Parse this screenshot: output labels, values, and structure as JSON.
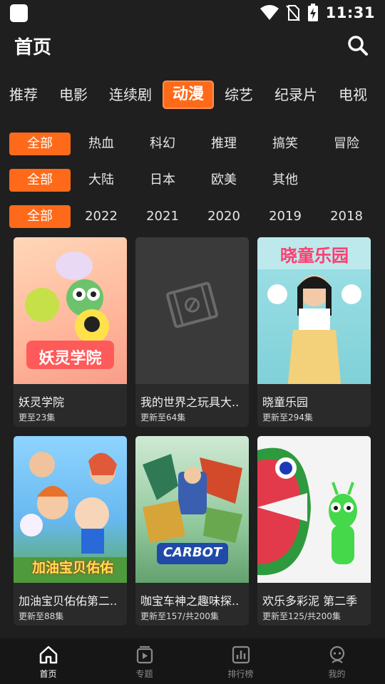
{
  "status_bar": {
    "time": "11:31"
  },
  "header": {
    "title": "首页",
    "search_icon": "search-icon"
  },
  "tabs": [
    {
      "label": "推荐",
      "active": false
    },
    {
      "label": "电影",
      "active": false
    },
    {
      "label": "连续剧",
      "active": false
    },
    {
      "label": "动漫",
      "active": true
    },
    {
      "label": "综艺",
      "active": false
    },
    {
      "label": "纪录片",
      "active": false
    },
    {
      "label": "电视",
      "active": false
    }
  ],
  "filters": {
    "genre": [
      "全部",
      "热血",
      "科幻",
      "推理",
      "搞笑",
      "冒险"
    ],
    "region": [
      "全部",
      "大陆",
      "日本",
      "欧美",
      "其他"
    ],
    "year": [
      "全部",
      "2022",
      "2021",
      "2020",
      "2019",
      "2018"
    ]
  },
  "cards": [
    {
      "title": "妖灵学院",
      "subtitle": "更至23集",
      "poster_text": "妖灵学院"
    },
    {
      "title": "我的世界之玩具大..",
      "subtitle": "更新至64集",
      "poster_text": ""
    },
    {
      "title": "晓童乐园",
      "subtitle": "更新至294集",
      "poster_text": "晓童乐园"
    },
    {
      "title": "加油宝贝佑佑第二..",
      "subtitle": "更新至88集",
      "poster_text": "加油宝贝佑佑"
    },
    {
      "title": "咖宝车神之趣味探..",
      "subtitle": "更新至157/共200集",
      "poster_text": "CARBOT"
    },
    {
      "title": "欢乐多彩泥 第二季",
      "subtitle": "更新至125/共200集",
      "poster_text": ""
    }
  ],
  "bottom_nav": [
    {
      "label": "首页",
      "icon": "home-icon",
      "active": true
    },
    {
      "label": "专题",
      "icon": "topic-icon",
      "active": false
    },
    {
      "label": "排行榜",
      "icon": "ranking-icon",
      "active": false
    },
    {
      "label": "我的",
      "icon": "profile-icon",
      "active": false
    }
  ],
  "colors": {
    "accent": "#ff6a1a",
    "background": "#1f1f1f",
    "nav_background": "#161616"
  }
}
